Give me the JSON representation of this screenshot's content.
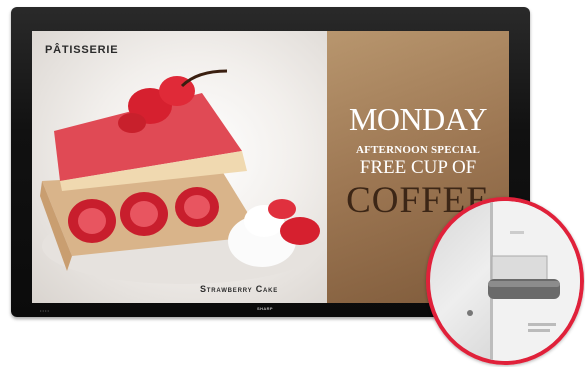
{
  "screen": {
    "brand": "PÂTISSERIE",
    "product": "Strawberry Cake",
    "ad": {
      "line1": "MONDAY",
      "line2": "AFTERNOON SPECIAL",
      "line3": "FREE CUP OF",
      "line4": "COFFEE"
    }
  },
  "monitor": {
    "logo": "SHARP"
  },
  "colors": {
    "ad_panel": "#9c7652",
    "callout_ring": "#e0213a",
    "bezel": "#111111"
  }
}
